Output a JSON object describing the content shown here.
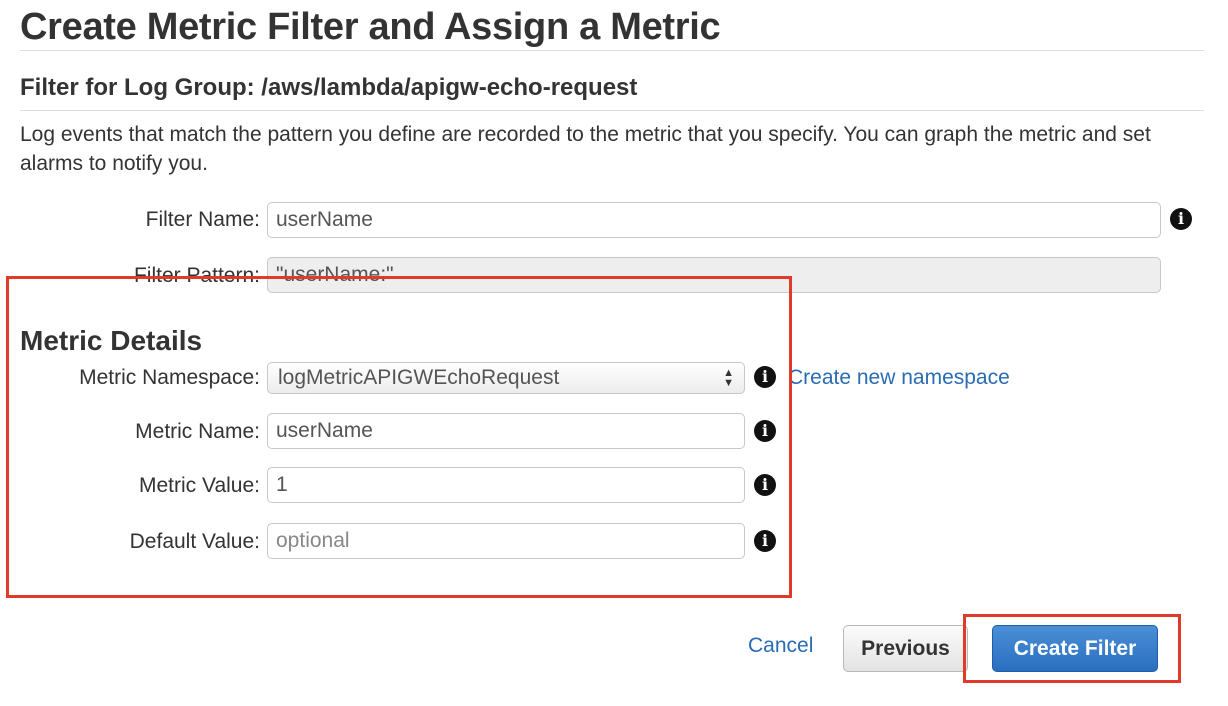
{
  "header": {
    "title": "Create Metric Filter and Assign a Metric",
    "subtitle": "Filter for Log Group: /aws/lambda/apigw-echo-request",
    "description": "Log events that match the pattern you define are recorded to the metric that you specify. You can graph the metric and set alarms to notify you."
  },
  "filter": {
    "name_label": "Filter Name:",
    "name_value": "userName",
    "pattern_label": "Filter Pattern:",
    "pattern_value": "\"userName:\""
  },
  "metric": {
    "section_title": "Metric Details",
    "namespace_label": "Metric Namespace:",
    "namespace_value": "logMetricAPIGWEchoRequest",
    "create_namespace_link": "Create new namespace",
    "name_label": "Metric Name:",
    "name_value": "userName",
    "value_label": "Metric Value:",
    "value_value": "1",
    "default_label": "Default Value:",
    "default_placeholder": "optional"
  },
  "actions": {
    "cancel_label": "Cancel",
    "previous_label": "Previous",
    "create_label": "Create Filter"
  },
  "colors": {
    "highlight": "#e03a2a",
    "link": "#2a6bb5",
    "primary_button": "#2a6ec0"
  },
  "icons": {
    "info": "info-icon"
  }
}
